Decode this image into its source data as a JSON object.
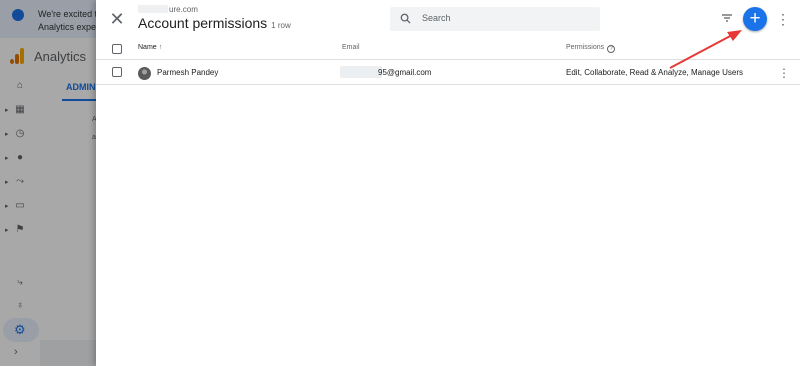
{
  "background_app": {
    "banner_line1": "We're excited to",
    "banner_line2": "Analytics exper",
    "app_name": "Analytics",
    "admin_tab": "ADMIN",
    "fragment_a": "A",
    "fragment_b": "a"
  },
  "panel": {
    "domain_suffix": "ure.com",
    "title": "Account permissions",
    "row_count": "1 row",
    "search_placeholder": "Search"
  },
  "table": {
    "columns": {
      "name": "Name",
      "email": "Email",
      "permissions": "Permissions"
    },
    "sort_arrow": "↑",
    "rows": [
      {
        "name": "Parmesh Pandey",
        "email_visible": "95@gmail.com",
        "permissions": "Edit, Collaborate, Read & Analyze, Manage Users"
      }
    ]
  },
  "icons": {
    "close": "close-icon",
    "search": "search-icon",
    "filter": "filter-icon",
    "add": "add-icon",
    "more": "more-vert-icon",
    "help": "help-icon"
  },
  "colors": {
    "accent": "#1a73e8",
    "annotation_arrow": "#e53935"
  }
}
